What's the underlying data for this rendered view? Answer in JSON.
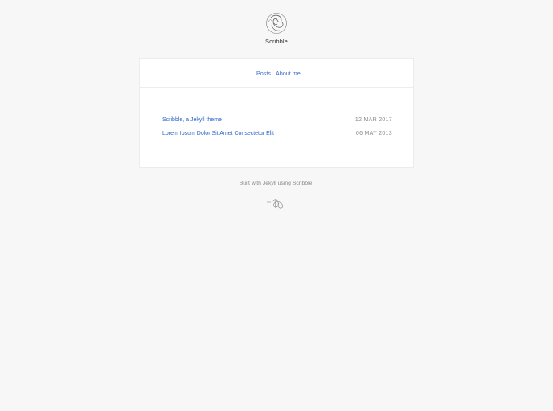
{
  "header": {
    "logo_icon": "scribble-avatar-icon",
    "site_title": "Scribble"
  },
  "nav": {
    "items": [
      {
        "label": "Posts"
      },
      {
        "label": "About me"
      }
    ],
    "link_color": "#3b6cc9"
  },
  "posts": [
    {
      "title": "Scribble, a Jekyll theme",
      "date": "12 MAR 2017"
    },
    {
      "title": "Lorem Ipsum Dolor Sit Amet Consectetur Elit",
      "date": "06 MAY 2013"
    }
  ],
  "footer": {
    "text": "Built with Jekyll using Scribble.",
    "signature_icon": "signature-scribble-icon"
  },
  "colors": {
    "background": "#f7f7f7",
    "card": "#ffffff",
    "link": "#2a63c8",
    "muted": "#888888"
  }
}
